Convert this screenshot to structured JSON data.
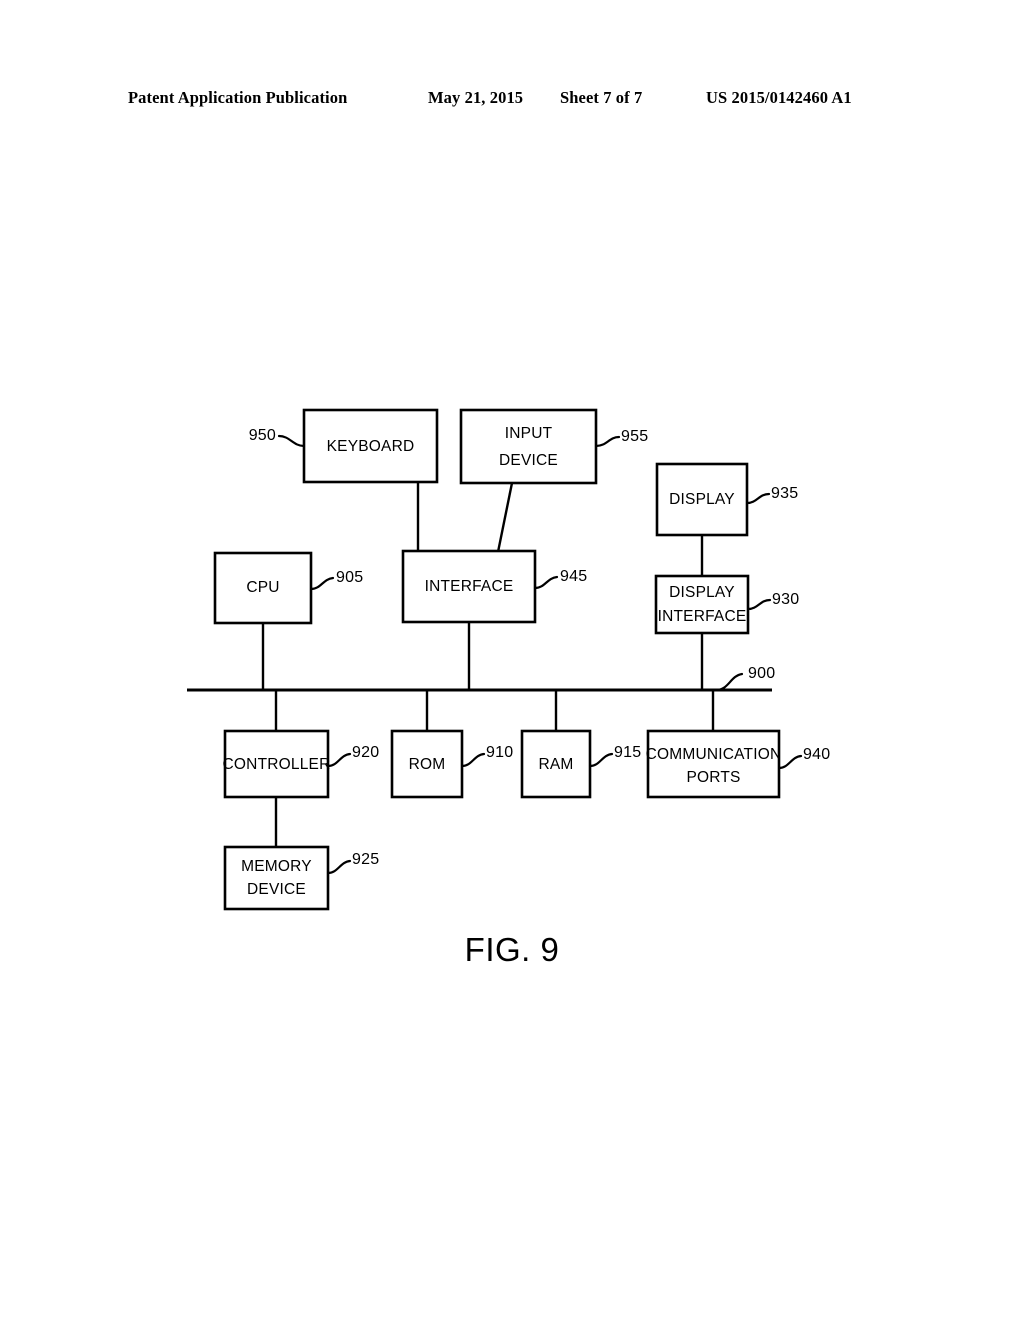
{
  "header": {
    "publication": "Patent Application Publication",
    "date": "May 21, 2015",
    "sheet": "Sheet 7 of 7",
    "patent_number": "US 2015/0142460 A1"
  },
  "figure": {
    "caption": "FIG. 9",
    "bus_label": "900",
    "blocks": [
      {
        "id": "keyboard",
        "label": "KEYBOARD",
        "ref": "950"
      },
      {
        "id": "input-device",
        "label_line1": "INPUT",
        "label_line2": "DEVICE",
        "ref": "955"
      },
      {
        "id": "display",
        "label": "DISPLAY",
        "ref": "935"
      },
      {
        "id": "cpu",
        "label": "CPU",
        "ref": "905"
      },
      {
        "id": "interface",
        "label": "INTERFACE",
        "ref": "945"
      },
      {
        "id": "display-interface",
        "label_line1": "DISPLAY",
        "label_line2": "INTERFACE",
        "ref": "930"
      },
      {
        "id": "controller",
        "label": "CONTROLLER",
        "ref": "920"
      },
      {
        "id": "rom",
        "label": "ROM",
        "ref": "910"
      },
      {
        "id": "ram",
        "label": "RAM",
        "ref": "915"
      },
      {
        "id": "communication-ports",
        "label_line1": "COMMUNICATION",
        "label_line2": "PORTS",
        "ref": "940"
      },
      {
        "id": "memory-device",
        "label_line1": "MEMORY",
        "label_line2": "DEVICE",
        "ref": "925"
      }
    ]
  },
  "colors": {
    "ink": "#000000",
    "paper": "#ffffff"
  }
}
